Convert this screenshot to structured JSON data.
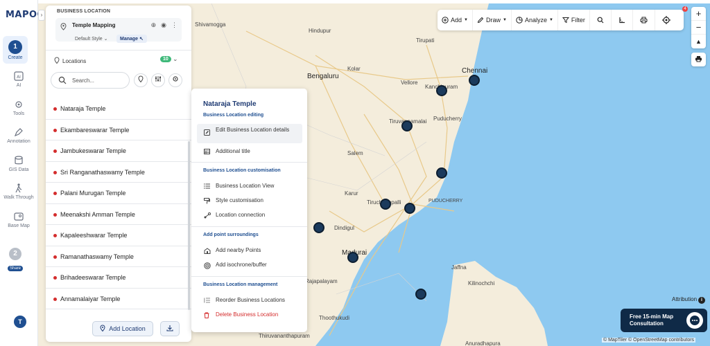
{
  "app": {
    "logo": "MAPOG"
  },
  "rail": {
    "steps": [
      {
        "num": "1",
        "label": "Create"
      },
      {
        "num": "2",
        "label": "Share"
      }
    ],
    "items": [
      {
        "label": "AI",
        "icon": "ai-icon"
      },
      {
        "label": "Tools",
        "icon": "tools-icon"
      },
      {
        "label": "Annotation",
        "icon": "annotation-icon"
      },
      {
        "label": "GIS Data",
        "icon": "layers-icon"
      },
      {
        "label": "Walk Through",
        "icon": "walk-icon"
      },
      {
        "label": "Base Map",
        "icon": "basemap-icon"
      }
    ],
    "avatar": "T"
  },
  "panel": {
    "section_title": "BUSINESS LOCATION",
    "layer_name": "Temple Mapping",
    "style_label": "Default Style",
    "manage_label": "Manage",
    "locations_label": "Locations",
    "locations_count": "10",
    "search_placeholder": "Search...",
    "locations": [
      "Nataraja Temple",
      "Ekambareswarar Temple",
      "Jambukeswarar Temple",
      "Sri Ranganathaswamy Temple",
      "Palani Murugan Temple",
      "Meenakshi Amman Temple",
      "Kapaleeshwarar Temple",
      "Ramanathaswamy Temple",
      "Brihadeeswarar Temple",
      "Annamalaiyar Temple"
    ],
    "add_location_label": "Add Location"
  },
  "context_menu": {
    "title": "Nataraja Temple",
    "sections": [
      {
        "title": "Business Location editing",
        "items": [
          "Edit Business Location details",
          "Additional title"
        ]
      },
      {
        "title": "Business Location customisation",
        "items": [
          "Business Location View",
          "Style customisation",
          "Location connection"
        ]
      },
      {
        "title": "Add point surroundings",
        "items": [
          "Add nearby Points",
          "Add isochrone/buffer"
        ]
      },
      {
        "title": "Business Location management",
        "items": [
          "Reorder Business Locations",
          "Delete Business Location"
        ]
      }
    ]
  },
  "toolbar": {
    "add": "Add",
    "draw": "Draw",
    "analyze": "Analyze",
    "filter": "Filter",
    "notification_count": "4"
  },
  "map": {
    "places": [
      "Shivamogga",
      "Hindupur",
      "Tirupati",
      "Bengaluru",
      "Kolar",
      "Chennai",
      "Vellore",
      "Kanchipuram",
      "Tiruvannamalai",
      "Puducherry",
      "Salem",
      "Karur",
      "Tiruchirappalli",
      "PUDUCHERRY",
      "Dindigul",
      "Madurai",
      "Jaffna",
      "Kilinochchi",
      "Rajapalayam",
      "Thoothukudi",
      "Thiruvananthapuram",
      "Anuradhapura"
    ],
    "colors": {
      "sea": "#8ec9f0",
      "land": "#f4eddc",
      "marker": "#1b3a5c"
    }
  },
  "consult": {
    "line1": "Free 15-min Map",
    "line2": "Consultation"
  },
  "attribution_label": "Attribution",
  "credit": "© MapTiler © OpenStreetMap contributors"
}
